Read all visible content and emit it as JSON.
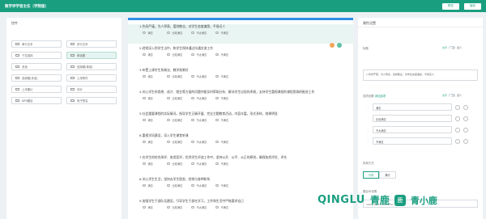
{
  "header": {
    "title": "教学评学官主任（学院版）",
    "preview_label": "预览",
    "save_label": "保存"
  },
  "left_panel": {
    "title": "控件",
    "controls": [
      {
        "label": "单行文本",
        "icon": "text-line-icon"
      },
      {
        "label": "多行文本",
        "icon": "text-area-icon"
      },
      {
        "label": "下拉选择",
        "icon": "dropdown-icon"
      },
      {
        "label": "单选题",
        "icon": "radio-icon"
      },
      {
        "label": "多选",
        "icon": "checkbox-icon"
      },
      {
        "label": "选择题(单选)",
        "icon": "radio-group-icon"
      },
      {
        "label": "选择题(多选)",
        "icon": "checkbox-group-icon"
      },
      {
        "label": "上传附件",
        "icon": "upload-icon"
      },
      {
        "label": "上传图片",
        "icon": "image-upload-icon"
      },
      {
        "label": "评分",
        "icon": "star-icon"
      },
      {
        "label": "NPS题目",
        "icon": "nps-icon"
      },
      {
        "label": "电子签名",
        "icon": "signature-icon"
      }
    ]
  },
  "questions": [
    {
      "text": "1.作风严谨，为人师表，爱岗敬业，对学生态度谦恳，平易近人",
      "options": [
        "满意",
        "比较满意",
        "不太满意",
        "不满意"
      ]
    },
    {
      "text": "2.经常深入到学生当中，和学生保持通过沟通交流工作",
      "options": [
        "满意",
        "比较满意",
        "不太满意",
        "不满意"
      ]
    },
    {
      "text": "3.布置上课学生系做法、教学效果好",
      "options": [
        "满意",
        "比较满意",
        "不太满意",
        "不满意"
      ]
    },
    {
      "text": "4.关心学生的思想、成才、就业等方面的问题并能及时帮助分析、解决学生出现的矛盾，支持学生重视课程的课程思政的推进工作",
      "options": [
        "满意",
        "比较满意",
        "不太满意",
        "不满意"
      ]
    },
    {
      "text": "5.社会重要课程的实际情况，指导学生正确开展、完全主题教育活动，内容丰富，形式多样，效果明显",
      "options": [
        "满意",
        "比较满意",
        "不太满意",
        "不满意"
      ]
    },
    {
      "text": "6.重视学风建设，深入学生课堂听课",
      "options": [
        "满意",
        "比较满意",
        "不太满意",
        "不满意"
      ]
    },
    {
      "text": "7.在学生的综合测评、各类奖评，优秀学生评选工作中，坚持公开、公平、公正的原则，确保各类评优、评先",
      "options": [
        "满意",
        "比较满意",
        "不太满意",
        "不满意"
      ]
    },
    {
      "text": "8.关心学生生活，坚持去学生宿舍，经常与各种联系",
      "options": [
        "满意",
        "比较满意",
        "不太满意",
        "不满意"
      ]
    },
    {
      "text": "9.加强学生干部队伍建设，引导学生干部在学习，工作和生活中严格要求自己",
      "options": [
        "满意",
        "比较满意",
        "不太满意",
        "不满意"
      ]
    }
  ],
  "right_panel": {
    "title": "属性设置",
    "title_label": "标题",
    "title_value": "1.作风严谨，为人师表，爱岗敬业，对学生态度谦恳，平易近人",
    "toggle_text": "文字",
    "toggle_image": "图片",
    "options_label": "选项设置",
    "options_link": "添加选项",
    "options": [
      "满意",
      "比较满意",
      "不太满意",
      "不满意"
    ],
    "layout_label": "布局方式",
    "layout_modes": [
      "行内",
      "换行"
    ],
    "id_label": "题目ID设置",
    "id_value": "radio_1621217455051_57"
  },
  "watermark": {
    "latin": "QINGLU",
    "cn": "青鹿",
    "logo_glyph": "鹿",
    "cn2": "青小鹿"
  },
  "colors": {
    "brand": "#1a9e80",
    "accent_blue": "#2f8fe6"
  }
}
